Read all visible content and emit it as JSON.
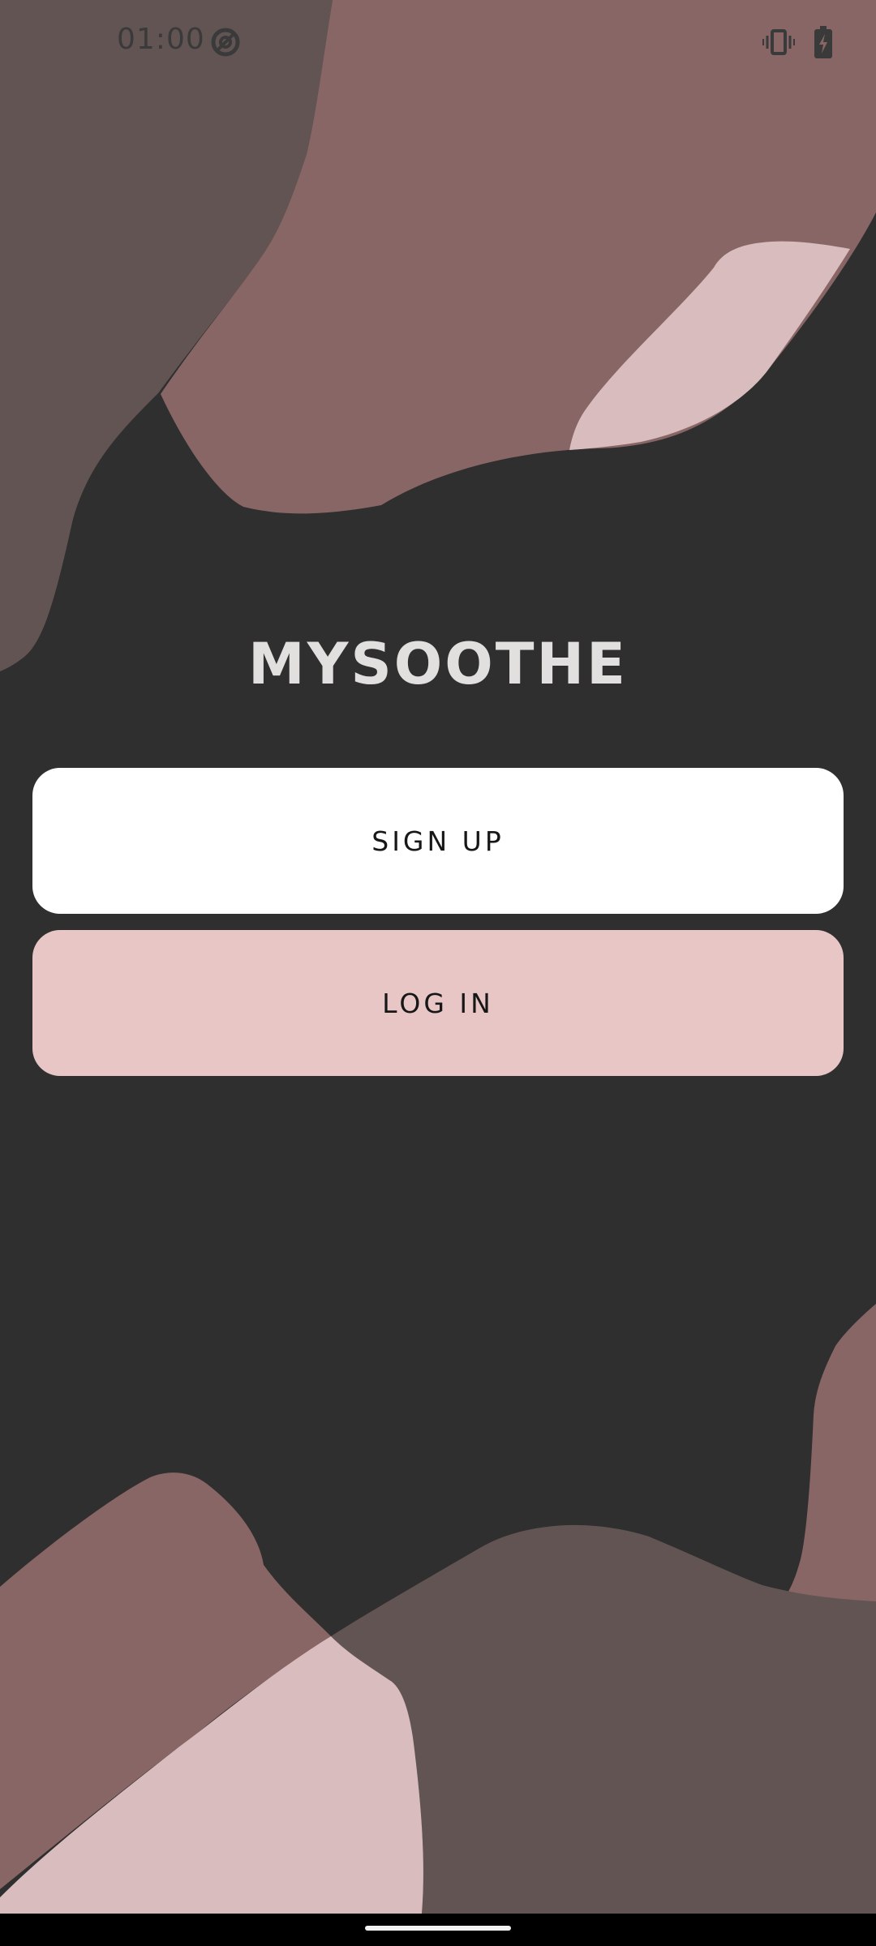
{
  "status_bar": {
    "time": "01:00",
    "icons": [
      "focus-mode-icon",
      "vibrate-icon",
      "battery-charging-icon"
    ]
  },
  "app": {
    "title": "MYSOOTHE"
  },
  "actions": {
    "signup_label": "SIGN UP",
    "login_label": "LOG IN"
  },
  "colors": {
    "background": "#2f2f2f",
    "blob_mauve": "#896666",
    "blob_dark_mauve": "#635454",
    "blob_light_pink": "#d9bcbd",
    "signup_button": "#ffffff",
    "login_button": "#e8c6c6",
    "title_text": "#e2e0de"
  },
  "navigation_bar": {
    "icons": [
      "home-gesture-handle"
    ]
  }
}
